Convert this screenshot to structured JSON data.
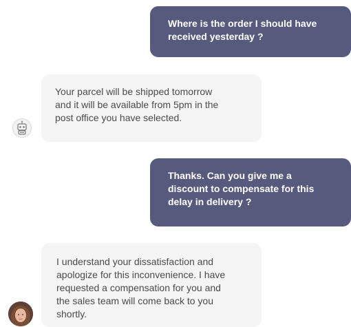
{
  "messages": [
    {
      "sender": "user",
      "lines": [
        "Where is the order I should have",
        "received yesterday ?"
      ]
    },
    {
      "sender": "bot",
      "lines": [
        "Your parcel will be shipped tomorrow",
        "and it will be available from 5pm in the",
        "post office you have selected."
      ]
    },
    {
      "sender": "user",
      "lines": [
        "Thanks. Can you give me a",
        "discount to compensate for this",
        "delay in delivery ?"
      ]
    },
    {
      "sender": "agent",
      "lines": [
        "I understand your dissatisfaction and",
        "apologize for this inconvenience. I have",
        "requested a compensation for you and",
        "the sales team will come back to you",
        "shortly."
      ]
    }
  ],
  "avatars": {
    "bot": "robot-icon",
    "agent": "agent-photo"
  },
  "colors": {
    "user_bubble": "#565a7c",
    "agent_bubble": "#f5f5f6",
    "user_text": "#ffffff",
    "agent_text": "#4a4a4a"
  }
}
